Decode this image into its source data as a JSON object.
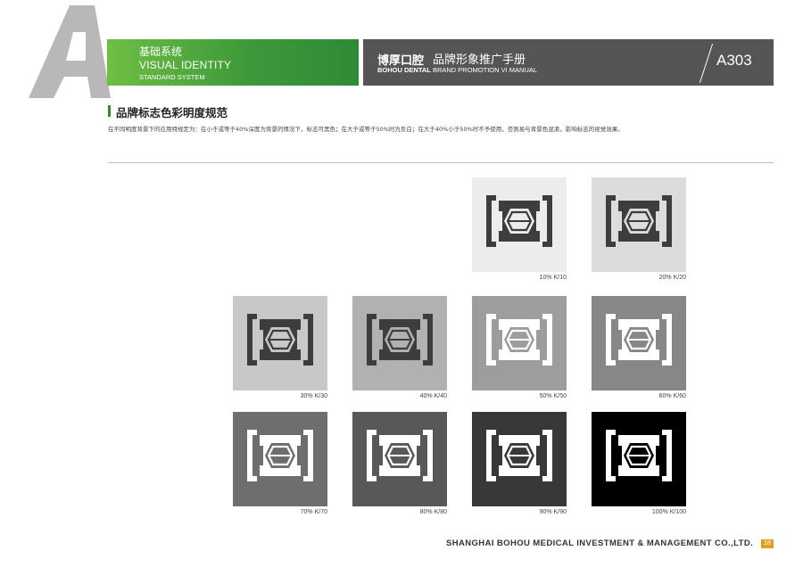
{
  "header": {
    "section_letter": "A",
    "section_cn": "基础系统",
    "section_en": "VISUAL IDENTITY",
    "section_en_sub": "STANDARD SYSTEM",
    "brand_cn": "博厚口腔",
    "title_cn": "品牌形象推广手册",
    "brand_en": "BOHOU DENTAL",
    "title_en": "BRAND PROMOTION VI MANUAL",
    "page_code": "A303"
  },
  "section": {
    "title": "品牌标志色彩明度规范",
    "description": "在不同明度背景下的应用特规定为：在小于或等于40%深度为背景的情况下，标志可黑色；在大于或等于50%时为反白；在大于40%小于50%时不予使用，否则易与背景色混淆，影响标志的视觉效果。"
  },
  "swatches": [
    {
      "label": "10%  K/10",
      "bg": "#ececec",
      "fg": "#3d3d3d",
      "inner": "#ececec"
    },
    {
      "label": "20%  K/20",
      "bg": "#dcdcdc",
      "fg": "#3d3d3d",
      "inner": "#dcdcdc"
    },
    {
      "label": "30%  K/30",
      "bg": "#c8c8c8",
      "fg": "#3d3d3d",
      "inner": "#c8c8c8"
    },
    {
      "label": "40%  K/40",
      "bg": "#b1b1b1",
      "fg": "#3d3d3d",
      "inner": "#b1b1b1"
    },
    {
      "label": "50%  K/50",
      "bg": "#9d9d9d",
      "fg": "#ffffff",
      "inner": "#9d9d9d"
    },
    {
      "label": "60%  K/60",
      "bg": "#878787",
      "fg": "#ffffff",
      "inner": "#878787"
    },
    {
      "label": "70%  K/70",
      "bg": "#6e6e6e",
      "fg": "#ffffff",
      "inner": "#6e6e6e"
    },
    {
      "label": "80%  K/80",
      "bg": "#585858",
      "fg": "#ffffff",
      "inner": "#585858"
    },
    {
      "label": "90%  K/90",
      "bg": "#383838",
      "fg": "#ffffff",
      "inner": "#383838"
    },
    {
      "label": "100%  K/100",
      "bg": "#000000",
      "fg": "#ffffff",
      "inner": "#000000"
    }
  ],
  "footer": {
    "company": "SHANGHAI BOHOU MEDICAL INVESTMENT & MANAGEMENT CO.,LTD.",
    "page_number": "18"
  }
}
